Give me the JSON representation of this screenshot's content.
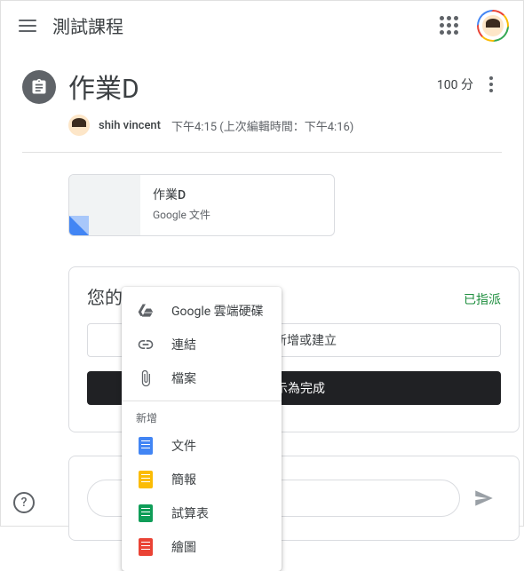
{
  "header": {
    "class_title": "測試課程",
    "avatar_label": "Student"
  },
  "assignment": {
    "title": "作業D",
    "points": "100 分",
    "author": "shih vincent",
    "timestamp": "下午4:15 (上次編輯時間：下午4:16)"
  },
  "attachment": {
    "name": "作業D",
    "type": "Google 文件"
  },
  "work": {
    "title": "您的作業",
    "status": "已指派",
    "add_label": "新增或建立",
    "done_label": "標示為完成"
  },
  "comment": {
    "placeholder": ""
  },
  "menu": {
    "items_top": [
      {
        "label": "Google 雲端硬碟",
        "icon": "drive-icon"
      },
      {
        "label": "連結",
        "icon": "link-icon"
      },
      {
        "label": "檔案",
        "icon": "attachment-icon"
      }
    ],
    "heading": "新增",
    "items_new": [
      {
        "label": "文件",
        "icon": "docs-icon"
      },
      {
        "label": "簡報",
        "icon": "slides-icon"
      },
      {
        "label": "試算表",
        "icon": "sheets-icon"
      },
      {
        "label": "繪圖",
        "icon": "drawings-icon"
      }
    ]
  }
}
